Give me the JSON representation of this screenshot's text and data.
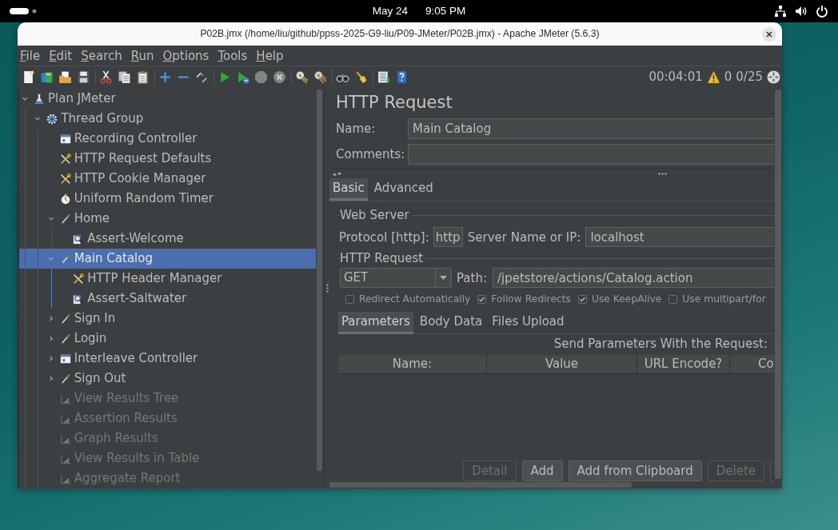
{
  "top_bar": {
    "date": "May 24",
    "time": "9:05 PM"
  },
  "window": {
    "title": "P02B.jmx (/home/liu/github/ppss-2025-G9-liu/P09-JMeter/P02B.jmx) - Apache JMeter (5.6.3)"
  },
  "menu": [
    "File",
    "Edit",
    "Search",
    "Run",
    "Options",
    "Tools",
    "Help"
  ],
  "toolbar": {
    "groups": [
      [
        {
          "kind": "new",
          "disabled": false
        },
        {
          "kind": "templates",
          "disabled": false
        },
        {
          "kind": "open",
          "disabled": false
        },
        {
          "kind": "save",
          "disabled": false
        }
      ],
      [
        {
          "kind": "cut",
          "disabled": false
        },
        {
          "kind": "copy",
          "disabled": false
        },
        {
          "kind": "paste",
          "disabled": false
        }
      ],
      [
        {
          "kind": "expand",
          "disabled": false
        },
        {
          "kind": "collapse",
          "disabled": false
        },
        {
          "kind": "toggle",
          "disabled": false
        }
      ],
      [
        {
          "kind": "start",
          "disabled": false
        },
        {
          "kind": "start_no_pauses",
          "disabled": false
        },
        {
          "kind": "stop",
          "disabled": true
        },
        {
          "kind": "shutdown",
          "disabled": true
        }
      ],
      [
        {
          "kind": "clear",
          "disabled": false
        },
        {
          "kind": "clear_all",
          "disabled": false
        }
      ],
      [
        {
          "kind": "search",
          "disabled": false
        },
        {
          "kind": "reset_search",
          "disabled": false
        }
      ],
      [
        {
          "kind": "functions",
          "disabled": false
        },
        {
          "kind": "help",
          "disabled": false
        }
      ]
    ],
    "elapsed": "00:04:01",
    "errors": "0",
    "threads": "0/25"
  },
  "tree": [
    {
      "label": "Plan JMeter",
      "kind": "test_plan",
      "expanded": true,
      "selected": false,
      "disabled": false,
      "children": [
        {
          "label": "Thread Group",
          "kind": "thread_group",
          "expanded": true,
          "selected": false,
          "disabled": false,
          "children": [
            {
              "label": "Recording Controller",
              "kind": "controller",
              "selected": false,
              "disabled": false
            },
            {
              "label": "HTTP Request Defaults",
              "kind": "config",
              "selected": false,
              "disabled": false
            },
            {
              "label": "HTTP Cookie Manager",
              "kind": "config",
              "selected": false,
              "disabled": false
            },
            {
              "label": "Uniform Random Timer",
              "kind": "timer",
              "selected": false,
              "disabled": false
            },
            {
              "label": "Home",
              "kind": "sampler",
              "expanded": true,
              "selected": false,
              "disabled": false,
              "children": [
                {
                  "label": "Assert-Welcome",
                  "kind": "assertion",
                  "selected": false,
                  "disabled": false
                }
              ]
            },
            {
              "label": "Main Catalog",
              "kind": "sampler",
              "expanded": true,
              "selected": true,
              "disabled": false,
              "children": [
                {
                  "label": "HTTP Header Manager",
                  "kind": "config",
                  "selected": false,
                  "disabled": false
                },
                {
                  "label": "Assert-Saltwater",
                  "kind": "assertion",
                  "selected": false,
                  "disabled": false
                }
              ]
            },
            {
              "label": "Sign In",
              "kind": "sampler",
              "expanded": false,
              "selected": false,
              "disabled": false
            },
            {
              "label": "Login",
              "kind": "sampler",
              "expanded": false,
              "selected": false,
              "disabled": false
            },
            {
              "label": "Interleave Controller",
              "kind": "controller",
              "expanded": false,
              "selected": false,
              "disabled": false
            },
            {
              "label": "Sign Out",
              "kind": "sampler",
              "expanded": false,
              "selected": false,
              "disabled": false
            },
            {
              "label": "View Results Tree",
              "kind": "listener",
              "selected": false,
              "disabled": true
            },
            {
              "label": "Assertion Results",
              "kind": "listener",
              "selected": false,
              "disabled": true
            },
            {
              "label": "Graph Results",
              "kind": "listener",
              "selected": false,
              "disabled": true
            },
            {
              "label": "View Results in Table",
              "kind": "listener",
              "selected": false,
              "disabled": true
            },
            {
              "label": "Aggregate Report",
              "kind": "listener",
              "selected": false,
              "disabled": true
            }
          ]
        }
      ]
    }
  ],
  "editor": {
    "title": "HTTP Request",
    "name_field": {
      "label": "Name:",
      "value": "Main Catalog"
    },
    "comments_field": {
      "label": "Comments:"
    },
    "tabs": [
      {
        "label": "Basic",
        "selected": true
      },
      {
        "label": "Advanced",
        "selected": false
      }
    ],
    "web_server": {
      "title": "Web Server",
      "protocol": {
        "label": "Protocol [http]:",
        "value": "http"
      },
      "server": {
        "label": "Server Name or IP:",
        "value": "localhost"
      }
    },
    "http_request": {
      "title": "HTTP Request",
      "method": "GET",
      "path": {
        "label": "Path:",
        "value": "/jpetstore/actions/Catalog.action"
      }
    },
    "options": [
      {
        "label": "Redirect Automatically",
        "checked": false
      },
      {
        "label": "Follow Redirects",
        "checked": true
      },
      {
        "label": "Use KeepAlive",
        "checked": true
      },
      {
        "label": "Use multipart/for",
        "checked": false
      }
    ],
    "body_tabs": [
      {
        "label": "Parameters",
        "selected": true
      },
      {
        "label": "Body Data",
        "selected": false
      },
      {
        "label": "Files Upload",
        "selected": false
      }
    ],
    "parameters": {
      "caption": "Send Parameters With the Request:",
      "columns": [
        "Name:",
        "Value",
        "URL Encode?",
        "Co"
      ]
    },
    "buttons": [
      {
        "label": "Detail",
        "disabled": true
      },
      {
        "label": "Add",
        "disabled": false
      },
      {
        "label": "Add from Clipboard",
        "disabled": false
      },
      {
        "label": "Delete",
        "disabled": true
      },
      {
        "disabled": true
      }
    ]
  }
}
